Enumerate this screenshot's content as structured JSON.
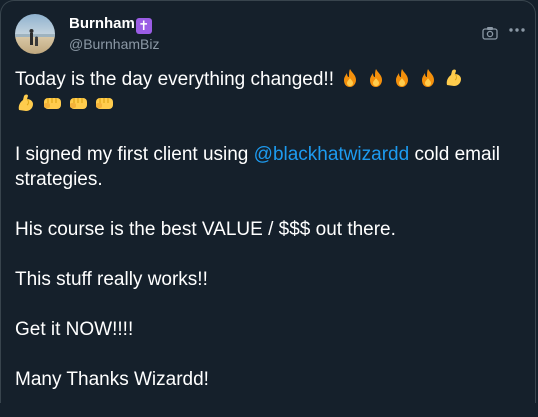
{
  "author": {
    "display_name": "Burnham",
    "badge_glyph": "✝",
    "handle": "@BurnhamBiz"
  },
  "tweet": {
    "line1_text": "Today is the day everything changed!!",
    "line2_prefix": "I signed my first client using",
    "mention": "@blackhatwizardd",
    "line2_suffix": "cold email strategies.",
    "line3": "His course is the best VALUE / $$$ out there.",
    "line4": "This stuff really works!!",
    "line5": "Get it NOW!!!!",
    "line6": "Many Thanks Wizardd!"
  },
  "icons": {
    "camera": "camera-icon",
    "more": "more-horizontal-icon",
    "fire": "fire-emoji",
    "flexed_biceps": "flexed-biceps-emoji",
    "fist": "oncoming-fist-emoji"
  },
  "colors": {
    "background": "#15202b",
    "text": "#ffffff",
    "secondary": "#8b98a5",
    "link": "#1d9bf0",
    "badge": "#9b5de5"
  }
}
